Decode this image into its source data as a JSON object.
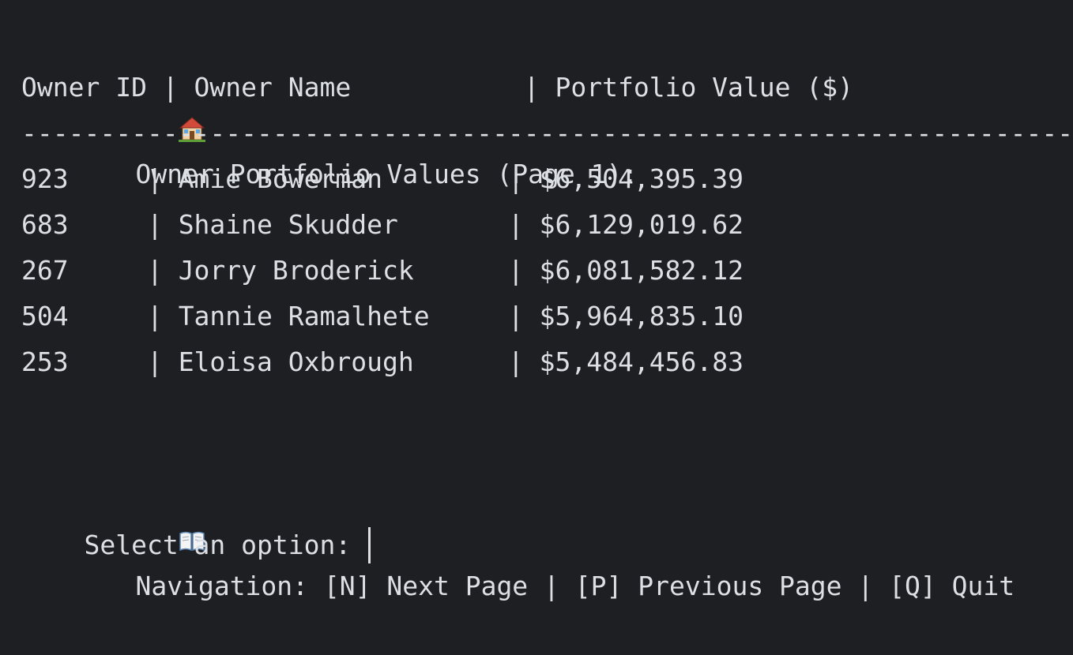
{
  "title": {
    "icon": "house-icon",
    "text": "Owner Portfolio Values (Page 1):"
  },
  "table": {
    "header": "Owner ID | Owner Name           | Portfolio Value ($)",
    "separator": "--------------------------------------------------------------------",
    "rows": [
      {
        "id": "923",
        "name": "Amie Bowerman",
        "value": "$6,504,395.39"
      },
      {
        "id": "683",
        "name": "Shaine Skudder",
        "value": "$6,129,019.62"
      },
      {
        "id": "267",
        "name": "Jorry Broderick",
        "value": "$6,081,582.12"
      },
      {
        "id": "504",
        "name": "Tannie Ramalhete",
        "value": "$5,964,835.10"
      },
      {
        "id": "253",
        "name": "Eloisa Oxbrough",
        "value": "$5,484,456.83"
      }
    ]
  },
  "navigation": {
    "icon": "open-book-icon",
    "text": "Navigation: [N] Next Page | [P] Previous Page | [Q] Quit"
  },
  "prompt": {
    "text": "Select an option: "
  }
}
